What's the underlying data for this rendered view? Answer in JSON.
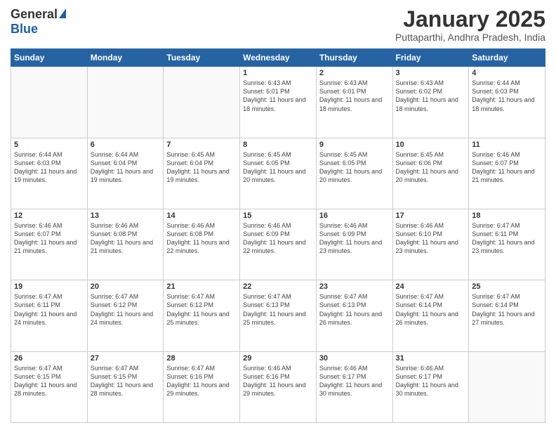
{
  "logo": {
    "general": "General",
    "blue": "Blue"
  },
  "header": {
    "month": "January 2025",
    "location": "Puttaparthi, Andhra Pradesh, India"
  },
  "days_of_week": [
    "Sunday",
    "Monday",
    "Tuesday",
    "Wednesday",
    "Thursday",
    "Friday",
    "Saturday"
  ],
  "weeks": [
    [
      {
        "day": "",
        "info": ""
      },
      {
        "day": "",
        "info": ""
      },
      {
        "day": "",
        "info": ""
      },
      {
        "day": "1",
        "info": "Sunrise: 6:43 AM\nSunset: 6:01 PM\nDaylight: 11 hours and 18 minutes."
      },
      {
        "day": "2",
        "info": "Sunrise: 6:43 AM\nSunset: 6:01 PM\nDaylight: 11 hours and 18 minutes."
      },
      {
        "day": "3",
        "info": "Sunrise: 6:43 AM\nSunset: 6:02 PM\nDaylight: 11 hours and 18 minutes."
      },
      {
        "day": "4",
        "info": "Sunrise: 6:44 AM\nSunset: 6:03 PM\nDaylight: 11 hours and 18 minutes."
      }
    ],
    [
      {
        "day": "5",
        "info": "Sunrise: 6:44 AM\nSunset: 6:03 PM\nDaylight: 11 hours and 19 minutes."
      },
      {
        "day": "6",
        "info": "Sunrise: 6:44 AM\nSunset: 6:04 PM\nDaylight: 11 hours and 19 minutes."
      },
      {
        "day": "7",
        "info": "Sunrise: 6:45 AM\nSunset: 6:04 PM\nDaylight: 11 hours and 19 minutes."
      },
      {
        "day": "8",
        "info": "Sunrise: 6:45 AM\nSunset: 6:05 PM\nDaylight: 11 hours and 20 minutes."
      },
      {
        "day": "9",
        "info": "Sunrise: 6:45 AM\nSunset: 6:05 PM\nDaylight: 11 hours and 20 minutes."
      },
      {
        "day": "10",
        "info": "Sunrise: 6:45 AM\nSunset: 6:06 PM\nDaylight: 11 hours and 20 minutes."
      },
      {
        "day": "11",
        "info": "Sunrise: 6:46 AM\nSunset: 6:07 PM\nDaylight: 11 hours and 21 minutes."
      }
    ],
    [
      {
        "day": "12",
        "info": "Sunrise: 6:46 AM\nSunset: 6:07 PM\nDaylight: 11 hours and 21 minutes."
      },
      {
        "day": "13",
        "info": "Sunrise: 6:46 AM\nSunset: 6:08 PM\nDaylight: 11 hours and 21 minutes."
      },
      {
        "day": "14",
        "info": "Sunrise: 6:46 AM\nSunset: 6:08 PM\nDaylight: 11 hours and 22 minutes."
      },
      {
        "day": "15",
        "info": "Sunrise: 6:46 AM\nSunset: 6:09 PM\nDaylight: 11 hours and 22 minutes."
      },
      {
        "day": "16",
        "info": "Sunrise: 6:46 AM\nSunset: 6:09 PM\nDaylight: 11 hours and 23 minutes."
      },
      {
        "day": "17",
        "info": "Sunrise: 6:46 AM\nSunset: 6:10 PM\nDaylight: 11 hours and 23 minutes."
      },
      {
        "day": "18",
        "info": "Sunrise: 6:47 AM\nSunset: 6:11 PM\nDaylight: 11 hours and 23 minutes."
      }
    ],
    [
      {
        "day": "19",
        "info": "Sunrise: 6:47 AM\nSunset: 6:11 PM\nDaylight: 11 hours and 24 minutes."
      },
      {
        "day": "20",
        "info": "Sunrise: 6:47 AM\nSunset: 6:12 PM\nDaylight: 11 hours and 24 minutes."
      },
      {
        "day": "21",
        "info": "Sunrise: 6:47 AM\nSunset: 6:12 PM\nDaylight: 11 hours and 25 minutes."
      },
      {
        "day": "22",
        "info": "Sunrise: 6:47 AM\nSunset: 6:13 PM\nDaylight: 11 hours and 25 minutes."
      },
      {
        "day": "23",
        "info": "Sunrise: 6:47 AM\nSunset: 6:13 PM\nDaylight: 11 hours and 26 minutes."
      },
      {
        "day": "24",
        "info": "Sunrise: 6:47 AM\nSunset: 6:14 PM\nDaylight: 11 hours and 26 minutes."
      },
      {
        "day": "25",
        "info": "Sunrise: 6:47 AM\nSunset: 6:14 PM\nDaylight: 11 hours and 27 minutes."
      }
    ],
    [
      {
        "day": "26",
        "info": "Sunrise: 6:47 AM\nSunset: 6:15 PM\nDaylight: 11 hours and 28 minutes."
      },
      {
        "day": "27",
        "info": "Sunrise: 6:47 AM\nSunset: 6:15 PM\nDaylight: 11 hours and 28 minutes."
      },
      {
        "day": "28",
        "info": "Sunrise: 6:47 AM\nSunset: 6:16 PM\nDaylight: 11 hours and 29 minutes."
      },
      {
        "day": "29",
        "info": "Sunrise: 6:46 AM\nSunset: 6:16 PM\nDaylight: 11 hours and 29 minutes."
      },
      {
        "day": "30",
        "info": "Sunrise: 6:46 AM\nSunset: 6:17 PM\nDaylight: 11 hours and 30 minutes."
      },
      {
        "day": "31",
        "info": "Sunrise: 6:46 AM\nSunset: 6:17 PM\nDaylight: 11 hours and 30 minutes."
      },
      {
        "day": "",
        "info": ""
      }
    ]
  ]
}
